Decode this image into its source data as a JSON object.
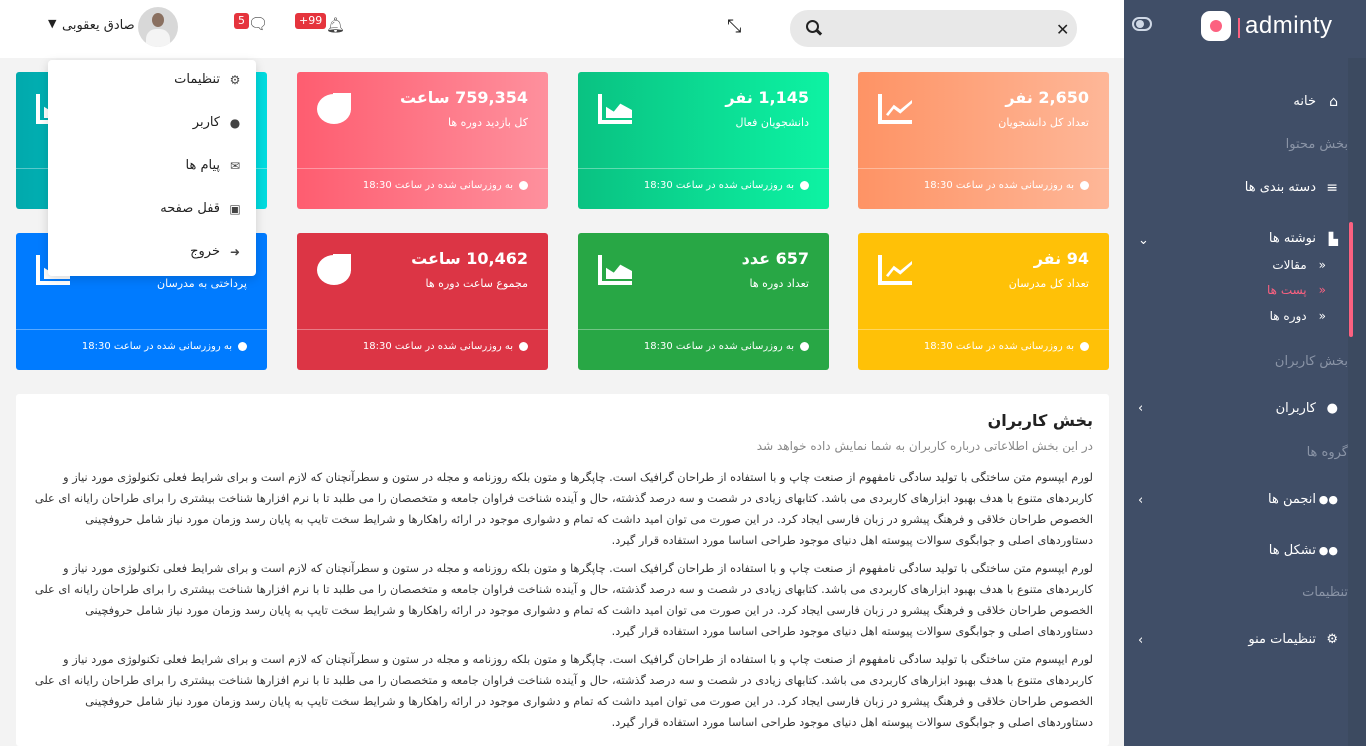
{
  "brand": {
    "name": "adminty",
    "accent": "#fc6180"
  },
  "header": {
    "search": {
      "placeholder": "",
      "value": ""
    },
    "notifications": {
      "badge": "+99"
    },
    "messages": {
      "badge": "5"
    },
    "user": {
      "name": "صادق یعقوبی"
    }
  },
  "user_menu": [
    {
      "label": "تنظیمات",
      "icon": "gear-icon"
    },
    {
      "label": "کاربر",
      "icon": "user-icon"
    },
    {
      "label": "پیام ها",
      "icon": "envelope-icon"
    },
    {
      "label": "قفل صفحه",
      "icon": "lock-icon"
    },
    {
      "label": "خروج",
      "icon": "sign-out-icon"
    }
  ],
  "sidebar": {
    "home": "خانه",
    "content_heading": "بخش محتوا",
    "categories": "دسته بندی ها",
    "posts": "نوشته ها",
    "posts_sub": [
      "مقالات",
      "پست ها",
      "دوره ها"
    ],
    "users_heading": "بخش کاربران",
    "users": "کاربران",
    "groups_heading": "گروه ها",
    "forums": "انجمن ها",
    "organizations": "تشکل ها",
    "settings_heading": "تنظیمات",
    "menu_settings": "تنظیمات منو"
  },
  "cards": [
    {
      "value": "2,650 نفر",
      "label": "تعداد کل دانشجویان",
      "footer": "به روزرسانی شده در ساعت 18:30",
      "color": "#fe9365",
      "icon": "line-chart-icon"
    },
    {
      "value": "1,145 نفر",
      "label": "دانشجویان فعال",
      "footer": "به روزرسانی شده در ساعت 18:30",
      "color": "#0ac282",
      "icon": "area-chart-icon"
    },
    {
      "value": "759,354 ساعت",
      "label": "کل بازدید دوره ها",
      "footer": "به روزرسانی شده در ساعت 18:30",
      "color": "#fe5d70",
      "icon": "pie-chart-icon"
    },
    {
      "value": "",
      "label": "",
      "footer": "",
      "color": "#01a9ac",
      "icon": "area-chart-icon"
    },
    {
      "value": "94 نفر",
      "label": "تعداد کل مدرسان",
      "footer": "به روزرسانی شده در ساعت 18:30",
      "color": "#ffc107",
      "icon": "line-chart-icon"
    },
    {
      "value": "657 عدد",
      "label": "تعداد دوره ها",
      "footer": "به روزرسانی شده در ساعت 18:30",
      "color": "#28a745",
      "icon": "area-chart-icon"
    },
    {
      "value": "10,462 ساعت",
      "label": "مجموع ساعت دوره ها",
      "footer": "به روزرسانی شده در ساعت 18:30",
      "color": "#dc3545",
      "icon": "pie-chart-icon"
    },
    {
      "value": "",
      "label": "پرداختی به مدرسان",
      "footer": "به روزرسانی شده در ساعت 18:30",
      "color": "#007bff",
      "icon": "area-chart-icon"
    }
  ],
  "panel": {
    "title": "بخش کاربران",
    "subtitle": "در این بخش اطلاعاتی درباره کاربران به شما نمایش داده خواهد شد",
    "paragraph": "لورم ایپسوم متن ساختگی با تولید سادگی نامفهوم از صنعت چاپ و با استفاده از طراحان گرافیک است. چاپگرها و متون بلکه روزنامه و مجله در ستون و سطرآنچنان که لازم است و برای شرایط فعلی تکنولوژی مورد نیاز و کاربردهای متنوع با هدف بهبود ابزارهای کاربردی می باشد. کتابهای زیادی در شصت و سه درصد گذشته، حال و آینده شناخت فراوان جامعه و متخصصان را می طلبد تا با نرم افزارها شناخت بیشتری را برای طراحان رایانه ای علی الخصوص طراحان خلاقی و فرهنگ پیشرو در زبان فارسی ایجاد کرد. در این صورت می توان امید داشت که تمام و دشواری موجود در ارائه راهکارها و شرایط سخت تایپ به پایان رسد وزمان مورد نیاز شامل حروفچینی دستاوردهای اصلی و جوابگوی سوالات پیوسته اهل دنیای موجود طراحی اساسا مورد استفاده قرار گیرد."
  }
}
